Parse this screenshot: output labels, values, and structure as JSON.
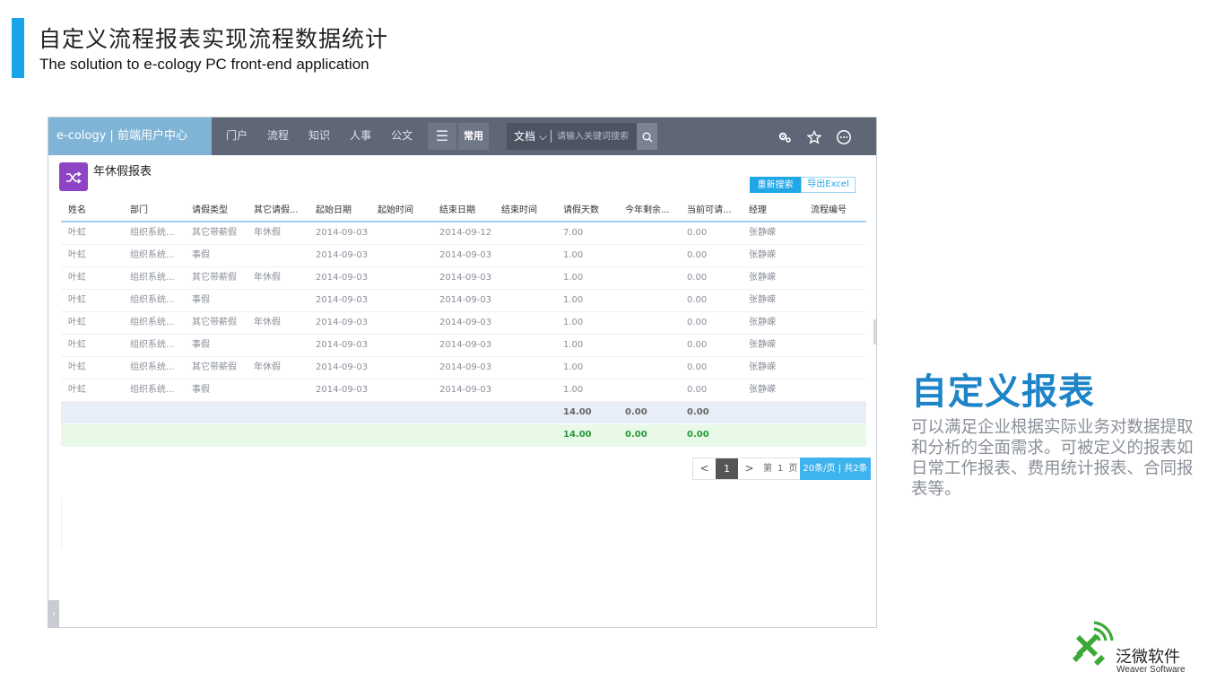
{
  "slide": {
    "title": "自定义流程报表实现流程数据统计",
    "subtitle": "The solution to e-cology PC front-end application"
  },
  "app": {
    "brand": "e-cology | 前端用户中心",
    "nav": [
      "门户",
      "流程",
      "知识",
      "人事",
      "公文"
    ],
    "menu_icon": "hamburger-icon",
    "common_label": "常用",
    "search": {
      "scope": "文档",
      "placeholder": "请输入关键词搜索"
    },
    "right_icons": [
      "settings-icon",
      "star-icon",
      "more-icon"
    ]
  },
  "report": {
    "title": "年休假报表",
    "btn_research": "重新搜索",
    "btn_export": "导出Excel",
    "columns": [
      "姓名",
      "部门",
      "请假类型",
      "其它请假...",
      "起始日期",
      "起始时间",
      "结束日期",
      "结束时间",
      "请假天数",
      "今年剩余...",
      "当前可请...",
      "经理",
      "流程编号"
    ],
    "rows": [
      [
        "叶虹",
        "组织系统...",
        "其它带薪假",
        "年休假",
        "2014-09-03",
        "",
        "2014-09-12",
        "",
        "7.00",
        "",
        "0.00",
        "张静嵘",
        ""
      ],
      [
        "叶虹",
        "组织系统...",
        "事假",
        "",
        "2014-09-03",
        "",
        "2014-09-03",
        "",
        "1.00",
        "",
        "0.00",
        "张静嵘",
        ""
      ],
      [
        "叶虹",
        "组织系统...",
        "其它带薪假",
        "年休假",
        "2014-09-03",
        "",
        "2014-09-03",
        "",
        "1.00",
        "",
        "0.00",
        "张静嵘",
        ""
      ],
      [
        "叶虹",
        "组织系统...",
        "事假",
        "",
        "2014-09-03",
        "",
        "2014-09-03",
        "",
        "1.00",
        "",
        "0.00",
        "张静嵘",
        ""
      ],
      [
        "叶虹",
        "组织系统...",
        "其它带薪假",
        "年休假",
        "2014-09-03",
        "",
        "2014-09-03",
        "",
        "1.00",
        "",
        "0.00",
        "张静嵘",
        ""
      ],
      [
        "叶虹",
        "组织系统...",
        "事假",
        "",
        "2014-09-03",
        "",
        "2014-09-03",
        "",
        "1.00",
        "",
        "0.00",
        "张静嵘",
        ""
      ],
      [
        "叶虹",
        "组织系统...",
        "其它带薪假",
        "年休假",
        "2014-09-03",
        "",
        "2014-09-03",
        "",
        "1.00",
        "",
        "0.00",
        "张静嵘",
        ""
      ],
      [
        "叶虹",
        "组织系统...",
        "事假",
        "",
        "2014-09-03",
        "",
        "2014-09-03",
        "",
        "1.00",
        "",
        "0.00",
        "张静嵘",
        ""
      ]
    ],
    "subtotal": {
      "days": "14.00",
      "remaining": "0.00",
      "available": "0.00"
    },
    "total": {
      "days": "14.00",
      "remaining": "0.00",
      "available": "0.00"
    },
    "pager": {
      "prev": "<",
      "current": "1",
      "next": ">",
      "goto_prefix": "第",
      "goto_page": "1",
      "goto_suffix": "页",
      "size_info": "20条/页 | 共2条"
    }
  },
  "feature": {
    "title": "自定义报表",
    "description": "可以满足企业根据实际业务对数据提取和分析的全面需求。可被定义的报表如日常工作报表、费用统计报表、合同报表等。"
  },
  "logo": {
    "name": "泛微软件",
    "sub": "Weaver Software"
  },
  "colors": {
    "accent": "#1aa3e8",
    "nav_bg": "#5f6676",
    "brand_bg": "#7fb4d6",
    "report_icon": "#8e44c4",
    "feature_title": "#1e84c8",
    "logo_green": "#3aa935"
  }
}
